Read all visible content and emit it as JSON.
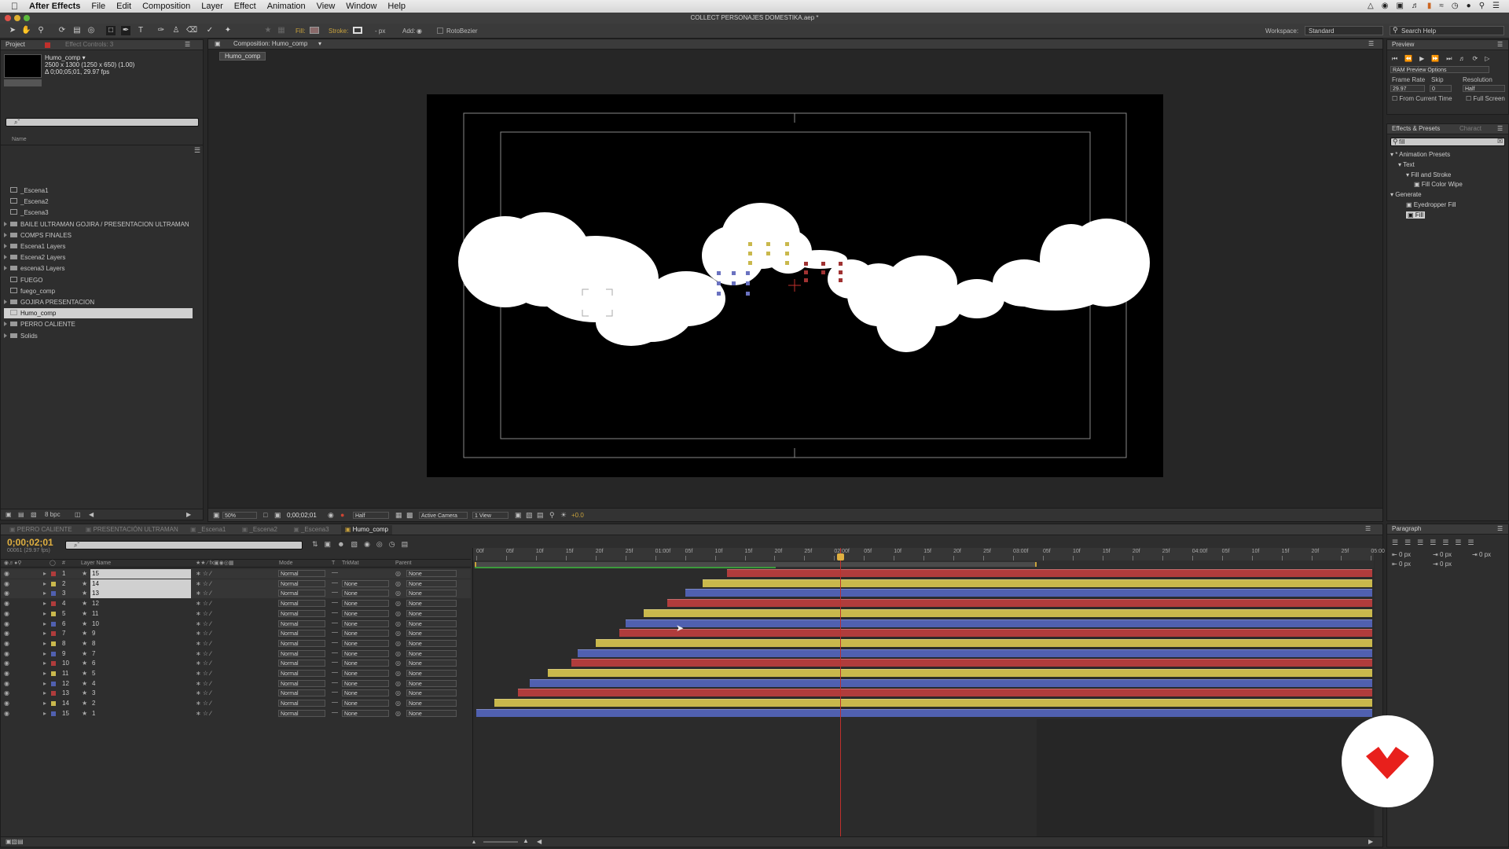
{
  "menubar": {
    "app": "After Effects",
    "items": [
      "File",
      "Edit",
      "Composition",
      "Layer",
      "Effect",
      "Animation",
      "View",
      "Window",
      "Help"
    ]
  },
  "window_title": "COLLECT PERSONAJES DOMESTIKA.aep *",
  "toolbar": {
    "fill_label": "Fill:",
    "stroke_label": "Stroke:",
    "stroke_px": "- px",
    "add_label": "Add:",
    "rotobezier": "RotoBezier",
    "workspace_label": "Workspace:",
    "workspace_value": "Standard",
    "search_help": "Search Help"
  },
  "project": {
    "tab_project": "Project",
    "tab_effect_controls": "Effect Controls: 3",
    "item_name": "Humo_comp ▾",
    "item_dims": "2500 x 1300  (1250 x 650) (1.00)",
    "item_duration": "Δ 0;00;05;01, 29.97 fps",
    "search_placeholder": "⌕ˇ",
    "col_name": "Name",
    "items": [
      {
        "label": "_Escena1",
        "type": "comp"
      },
      {
        "label": "_Escena2",
        "type": "comp"
      },
      {
        "label": "_Escena3",
        "type": "comp"
      },
      {
        "label": "BAILE ULTRAMAN GOJIRA / PRESENTACION ULTRAMAN",
        "type": "folder"
      },
      {
        "label": "COMPS FINALES",
        "type": "folder"
      },
      {
        "label": "Escena1 Layers",
        "type": "folder"
      },
      {
        "label": "Escena2 Layers",
        "type": "folder"
      },
      {
        "label": "escena3 Layers",
        "type": "folder"
      },
      {
        "label": "FUEGO",
        "type": "comp"
      },
      {
        "label": "fuego_comp",
        "type": "comp"
      },
      {
        "label": "GOJIRA PRESENTACION",
        "type": "folder"
      },
      {
        "label": "Humo_comp",
        "type": "comp",
        "selected": true
      },
      {
        "label": "PERRO CALIENTE",
        "type": "folder"
      },
      {
        "label": "Solids",
        "type": "folder"
      }
    ],
    "bpc": "8 bpc"
  },
  "viewer": {
    "tab": "Composition: Humo_comp",
    "comp_name_tab": "Humo_comp",
    "zoom": "50%",
    "timecode": "0;00;02;01",
    "resolution": "Half",
    "camera": "Active Camera",
    "views": "1 View",
    "exposure": "+0.0"
  },
  "preview": {
    "tab": "Preview",
    "ram_options": "RAM Preview Options",
    "frame_rate_label": "Frame Rate",
    "skip_label": "Skip",
    "resolution_label": "Resolution",
    "frame_rate": "29.97",
    "skip": "0",
    "resolution": "Half",
    "from_current": "From Current Time",
    "full_screen": "Full Screen"
  },
  "effects": {
    "tab": "Effects & Presets",
    "tab2": "Charact",
    "search": "fill",
    "tree": [
      {
        "label": "* Animation Presets",
        "indent": 0
      },
      {
        "label": "Text",
        "indent": 1
      },
      {
        "label": "Fill and Stroke",
        "indent": 2
      },
      {
        "label": "Fill Color Wipe",
        "indent": 3
      },
      {
        "label": "Generate",
        "indent": 0
      },
      {
        "label": "Eyedropper Fill",
        "indent": 2
      },
      {
        "label": "Fill",
        "indent": 2,
        "selected": true
      }
    ]
  },
  "paragraph": {
    "tab": "Paragraph",
    "values": [
      "0 px",
      "0 px",
      "0 px",
      "0 px",
      "0 px"
    ]
  },
  "timeline": {
    "tabs": [
      "PERRO CALIENTE",
      "PRESENTACIÓN ULTRAMAN",
      "_Escena1",
      "_Escena2",
      "_Escena3",
      "Humo_comp"
    ],
    "active_tab": "Humo_comp",
    "timecode": "0;00;02;01",
    "frame_info": "00061 (29.97 fps)",
    "search_placeholder": "⌕ˇ",
    "col_layer_name": "Layer Name",
    "col_mode": "Mode",
    "col_t": "T",
    "col_trkmat": "TrkMat",
    "col_parent": "Parent",
    "ruler": [
      "00f",
      "05f",
      "10f",
      "15f",
      "20f",
      "25f",
      "01:00f",
      "05f",
      "10f",
      "15f",
      "20f",
      "25f",
      "02:00f",
      "05f",
      "10f",
      "15f",
      "20f",
      "25f",
      "03:00f",
      "05f",
      "10f",
      "15f",
      "20f",
      "25f",
      "04:00f",
      "05f",
      "10f",
      "15f",
      "20f",
      "25f",
      "05:00"
    ],
    "playhead_frame": 61,
    "total_frames": 151,
    "work_area_end_frame": 94,
    "layers": [
      {
        "num": "1",
        "name": "15",
        "color": "#b03c3c",
        "mode": "Normal",
        "trkmat": "",
        "parent": "None",
        "in": 42
      },
      {
        "num": "2",
        "name": "14",
        "color": "#c9b84c",
        "mode": "Normal",
        "trkmat": "None",
        "parent": "None",
        "in": 38
      },
      {
        "num": "3",
        "name": "13",
        "color": "#5060b0",
        "mode": "Normal",
        "trkmat": "None",
        "parent": "None",
        "in": 35
      },
      {
        "num": "4",
        "name": "12",
        "color": "#b03c3c",
        "mode": "Normal",
        "trkmat": "None",
        "parent": "None",
        "in": 32
      },
      {
        "num": "5",
        "name": "11",
        "color": "#c9b84c",
        "mode": "Normal",
        "trkmat": "None",
        "parent": "None",
        "in": 28
      },
      {
        "num": "6",
        "name": "10",
        "color": "#5060b0",
        "mode": "Normal",
        "trkmat": "None",
        "parent": "None",
        "in": 25
      },
      {
        "num": "7",
        "name": "9",
        "color": "#b03c3c",
        "mode": "Normal",
        "trkmat": "None",
        "parent": "None",
        "in": 24
      },
      {
        "num": "8",
        "name": "8",
        "color": "#c9b84c",
        "mode": "Normal",
        "trkmat": "None",
        "parent": "None",
        "in": 20
      },
      {
        "num": "9",
        "name": "7",
        "color": "#5060b0",
        "mode": "Normal",
        "trkmat": "None",
        "parent": "None",
        "in": 17
      },
      {
        "num": "10",
        "name": "6",
        "color": "#b03c3c",
        "mode": "Normal",
        "trkmat": "None",
        "parent": "None",
        "in": 16
      },
      {
        "num": "11",
        "name": "5",
        "color": "#c9b84c",
        "mode": "Normal",
        "trkmat": "None",
        "parent": "None",
        "in": 12
      },
      {
        "num": "12",
        "name": "4",
        "color": "#5060b0",
        "mode": "Normal",
        "trkmat": "None",
        "parent": "None",
        "in": 9
      },
      {
        "num": "13",
        "name": "3",
        "color": "#b03c3c",
        "mode": "Normal",
        "trkmat": "None",
        "parent": "None",
        "in": 7
      },
      {
        "num": "14",
        "name": "2",
        "color": "#c9b84c",
        "mode": "Normal",
        "trkmat": "None",
        "parent": "None",
        "in": 3
      },
      {
        "num": "15",
        "name": "1",
        "color": "#5060b0",
        "mode": "Normal",
        "trkmat": "None",
        "parent": "None",
        "in": 0
      }
    ]
  }
}
